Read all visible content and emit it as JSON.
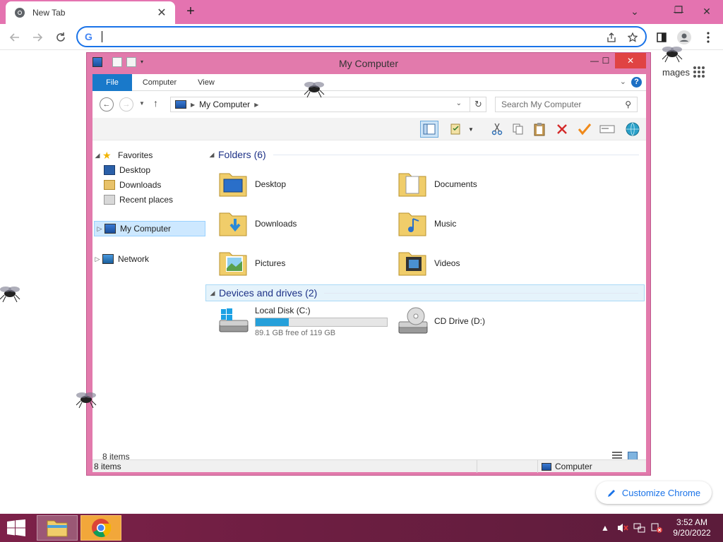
{
  "browser": {
    "tab_title": "New Tab",
    "omnibox_value": "",
    "ntp_images_label": "mages",
    "customize_label": "Customize Chrome"
  },
  "explorer": {
    "title": "My Computer",
    "ribbon_tabs": [
      "File",
      "Computer",
      "View"
    ],
    "address_path": "My Computer",
    "search_placeholder": "Search My Computer",
    "nav": {
      "favorites": "Favorites",
      "desktop": "Desktop",
      "downloads": "Downloads",
      "recent": "Recent places",
      "my_computer": "My Computer",
      "network": "Network"
    },
    "groups": {
      "folders": "Folders (6)",
      "devices": "Devices and drives (2)"
    },
    "folders": [
      "Desktop",
      "Documents",
      "Downloads",
      "Music",
      "Pictures",
      "Videos"
    ],
    "drives": [
      {
        "name": "Local Disk (C:)",
        "free_text": "89.1 GB free of 119 GB",
        "used_fraction": 0.251
      },
      {
        "name": "CD Drive (D:)"
      }
    ],
    "details_count": "8 items",
    "status_left": "8 items",
    "status_right": "Computer"
  },
  "taskbar": {
    "time": "3:52 AM",
    "date": "9/20/2022"
  },
  "colors": {
    "chrome_frame": "#e473b0",
    "window_frame": "#e27aac",
    "accent_blue": "#1979ca",
    "taskbar": "#6e1e42",
    "drive_fill": "#26a0da"
  }
}
